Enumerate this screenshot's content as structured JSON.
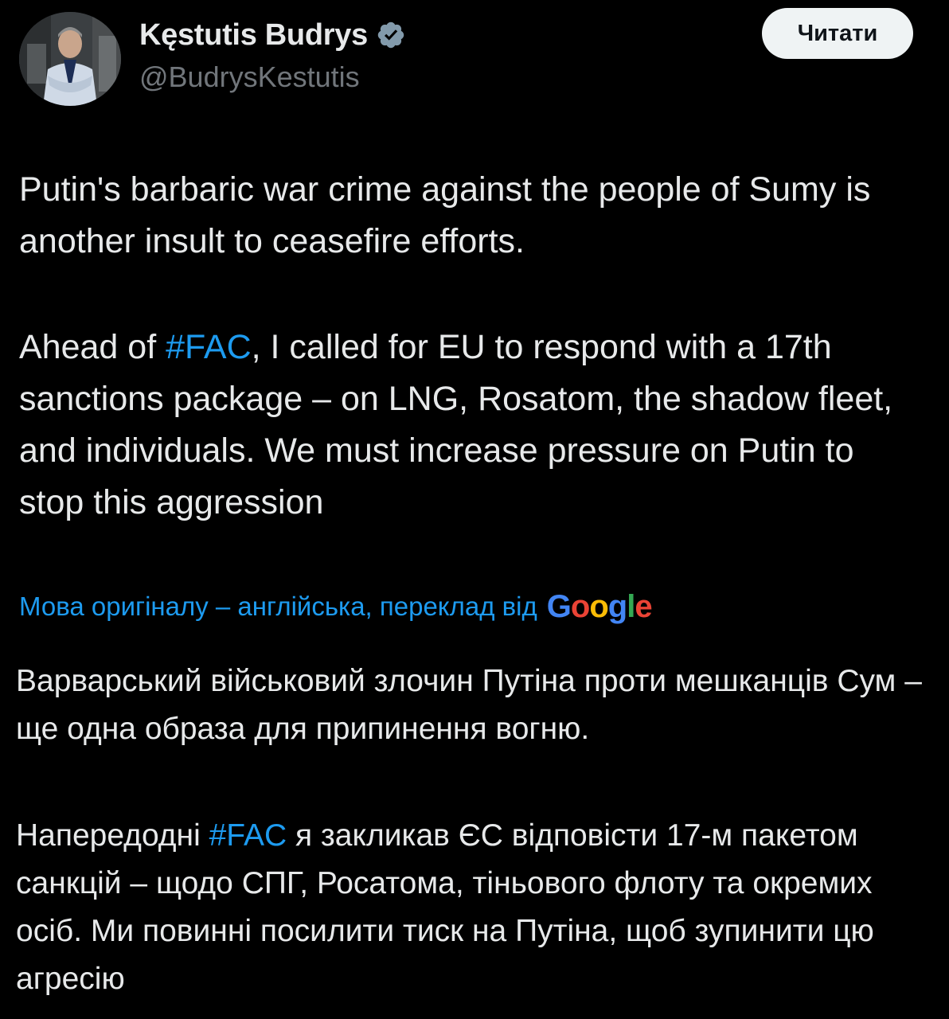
{
  "author": {
    "display_name": "Kęstutis Budrys",
    "handle": "@BudrysKestutis",
    "verified_icon": "verified-badge-icon",
    "avatar": "profile-photo"
  },
  "follow_button": {
    "label": "Читати"
  },
  "tweet": {
    "paragraph1": "Putin's barbaric war crime against the people of Sumy is another insult to ceasefire efforts.",
    "paragraph2_prefix": "Ahead of ",
    "paragraph2_hashtag": "#FAC",
    "paragraph2_suffix": ", I called for EU to respond with a 17th sanctions package – on LNG, Rosatom, the shadow fleet, and individuals. We must increase pressure on Putin to stop this aggression"
  },
  "translation": {
    "notice": "Мова оригіналу – англійська, переклад від",
    "provider": "Google",
    "paragraph1": "Варварський військовий злочин Путіна проти мешканців Сум – ще одна образа для припинення вогню.",
    "paragraph2_prefix": "Напередодні ",
    "paragraph2_hashtag": "#FAC",
    "paragraph2_suffix": " я закликав ЄС відповісти 17-м пакетом санкцій – щодо СПГ, Росатома, тіньового флоту та окремих осіб. Ми повинні посилити тиск на Путіна, щоб зупинити цю агресію"
  },
  "colors": {
    "background": "#000000",
    "text": "#e7e9ea",
    "secondary_text": "#71767b",
    "link": "#1d9bf0",
    "button_bg": "#eff3f4"
  }
}
